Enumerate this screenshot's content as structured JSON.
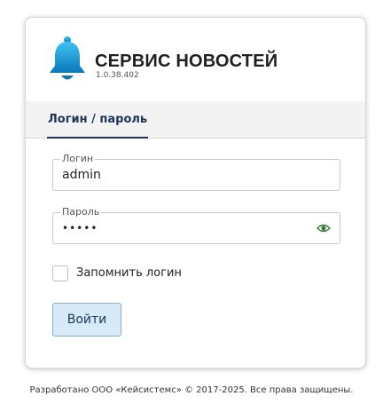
{
  "app": {
    "title": "СЕРВИС НОВОСТЕЙ",
    "version": "1.0.38.402"
  },
  "tabs": [
    {
      "label": "Логин / пароль",
      "active": true
    }
  ],
  "form": {
    "login_label": "Логин",
    "login_value": "admin",
    "password_label": "Пароль",
    "password_value": "•••••",
    "remember_label": "Запомнить логин",
    "remember_checked": false,
    "submit_label": "Войти"
  },
  "icons": {
    "logo": "bell-icon",
    "password_toggle": "eye-icon"
  },
  "colors": {
    "accent": "#1d3557",
    "button_bg": "#d6eaf8",
    "bell_top": "#3fc3f0",
    "bell_bottom": "#0a78b8"
  },
  "footer": {
    "text": "Разработано ООО «Кейсистемс» © 2017-2025. Все права защищены."
  }
}
